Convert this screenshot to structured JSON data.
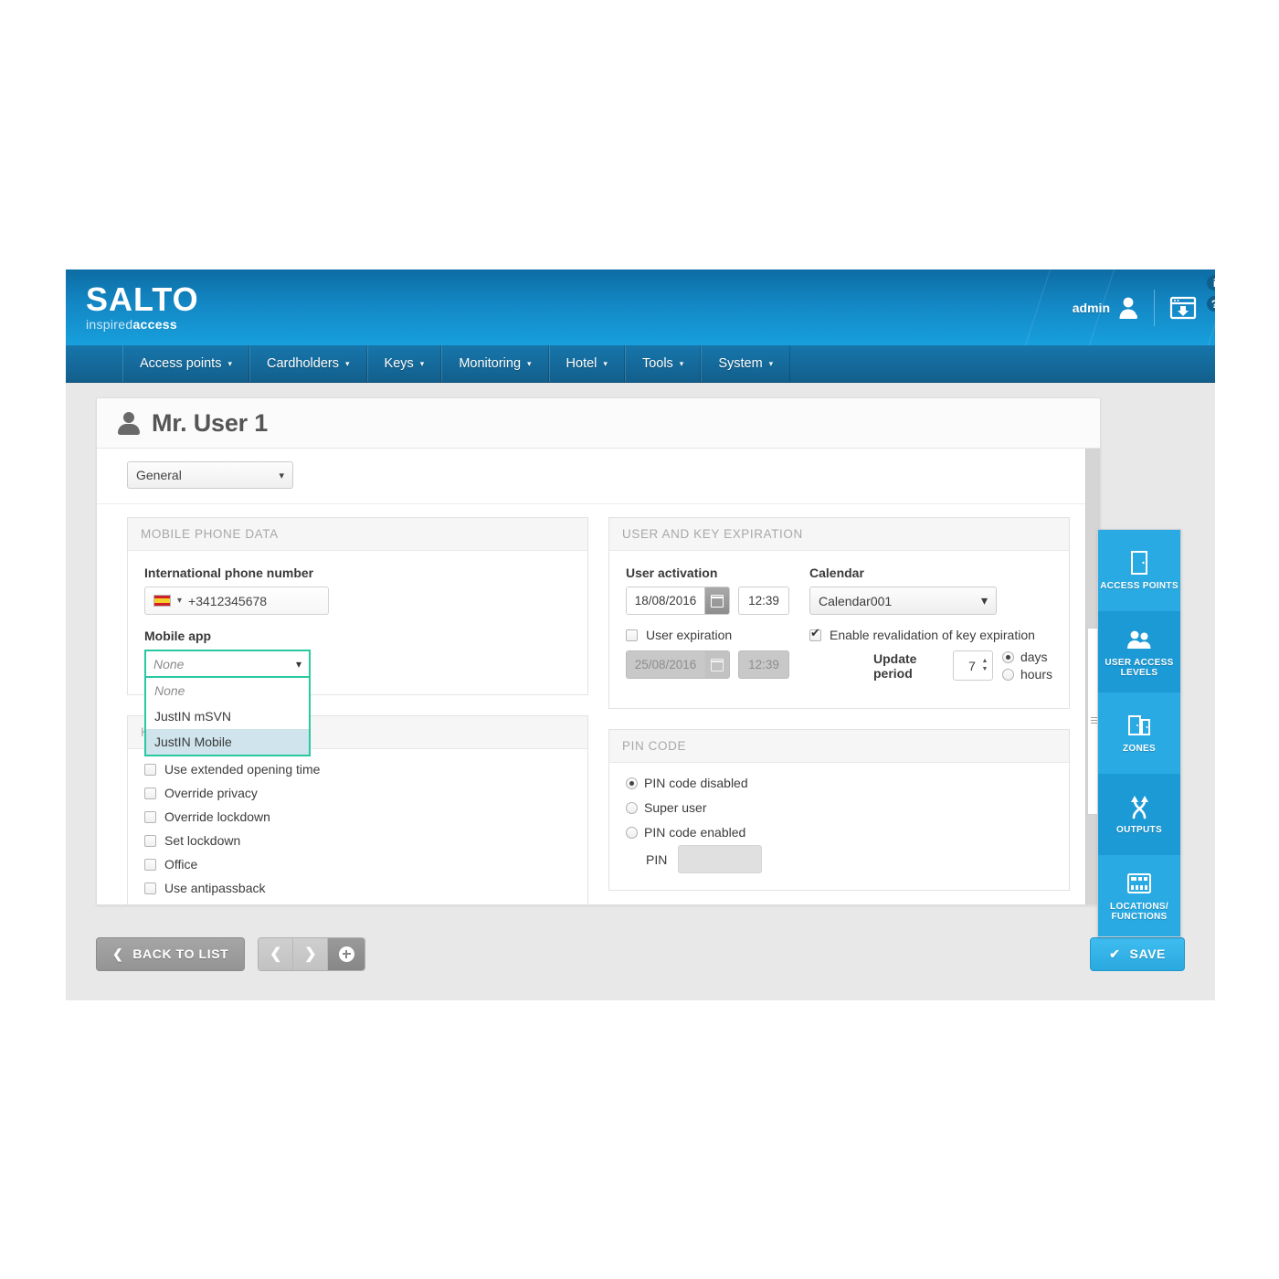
{
  "header": {
    "logo_main": "SALTO",
    "logo_sub_light": "inspired",
    "logo_sub_bold": "access",
    "user_label": "admin",
    "user_icon": "user-icon",
    "download_icon": "download-window-icon",
    "info_badge": "i",
    "help_badge": "?",
    "brand_color": "#1387c4"
  },
  "menu": {
    "items": [
      {
        "label": "Access points",
        "caret": "▾"
      },
      {
        "label": "Cardholders",
        "caret": "▾"
      },
      {
        "label": "Keys",
        "caret": "▾"
      },
      {
        "label": "Monitoring",
        "caret": "▾"
      },
      {
        "label": "Hotel",
        "caret": "▾"
      },
      {
        "label": "Tools",
        "caret": "▾"
      },
      {
        "label": "System",
        "caret": "▾"
      }
    ]
  },
  "page": {
    "title": "Mr. User 1",
    "avatar_icon": "user-avatar-icon",
    "tab_select_value": "General",
    "chevron": "⌄"
  },
  "mobile_phone_data": {
    "panel_title": "MOBILE PHONE DATA",
    "phone_label": "International phone number",
    "phone_value": "+3412345678",
    "country_flag": "spain-flag-icon",
    "mobile_app_label": "Mobile app",
    "mobile_app_value": "None",
    "dropdown_open": true,
    "dropdown_options": [
      {
        "label": "None",
        "placeholder": true,
        "selected": false
      },
      {
        "label": "JustIN mSVN",
        "placeholder": false,
        "selected": false
      },
      {
        "label": "JustIN Mobile",
        "placeholder": false,
        "selected": true
      }
    ]
  },
  "key_options": {
    "panel_title": "KEY OPTIONS",
    "items": [
      {
        "label": "Use extended opening time",
        "checked": false
      },
      {
        "label": "Override privacy",
        "checked": false
      },
      {
        "label": "Override lockdown",
        "checked": false
      },
      {
        "label": "Set lockdown",
        "checked": false
      },
      {
        "label": "Office",
        "checked": false
      },
      {
        "label": "Use antipassback",
        "checked": false
      }
    ]
  },
  "user_key_expiration": {
    "panel_title": "USER AND KEY EXPIRATION",
    "activation_label": "User activation",
    "activation_date": "18/08/2016",
    "activation_time": "12:39",
    "calendar_icon": "calendar-icon",
    "expiration_checkbox_label": "User expiration",
    "expiration_checked": false,
    "expiration_date": "25/08/2016",
    "expiration_time": "12:39",
    "calendar_label": "Calendar",
    "calendar_value": "Calendar001",
    "revalidation_label": "Enable revalidation of key expiration",
    "revalidation_checked": true,
    "update_period_label": "Update period",
    "update_period_value": "7",
    "spin_up": "▲",
    "spin_down": "▼",
    "unit_options": [
      {
        "label": "days",
        "selected": true
      },
      {
        "label": "hours",
        "selected": false
      }
    ]
  },
  "pin_code": {
    "panel_title": "PIN CODE",
    "options": [
      {
        "label": "PIN code disabled",
        "selected": true
      },
      {
        "label": "Super user",
        "selected": false
      },
      {
        "label": "PIN code enabled",
        "selected": false
      }
    ],
    "pin_label": "PIN",
    "pin_value": ""
  },
  "side_nav": {
    "items": [
      {
        "label": "ACCESS POINTS",
        "icon": "door-icon",
        "shade": "light"
      },
      {
        "label": "USER ACCESS\nLEVELS",
        "label_line1": "USER ACCESS",
        "label_line2": "LEVELS",
        "icon": "users-icon",
        "shade": "dark"
      },
      {
        "label": "ZONES",
        "icon": "double-door-icon",
        "shade": "light"
      },
      {
        "label": "OUTPUTS",
        "icon": "outputs-arrows-icon",
        "shade": "dark"
      },
      {
        "label": "LOCATIONS/\nFUNCTIONS",
        "label_line1": "LOCATIONS/",
        "label_line2": "FUNCTIONS",
        "icon": "locations-grid-icon",
        "shade": "light"
      }
    ]
  },
  "footer": {
    "back_label": "BACK TO LIST",
    "back_arrow": "❮",
    "prev_arrow": "❮",
    "next_arrow": "❯",
    "add_icon": "plus-circle-icon",
    "save_label": "SAVE",
    "save_check": "✔"
  }
}
